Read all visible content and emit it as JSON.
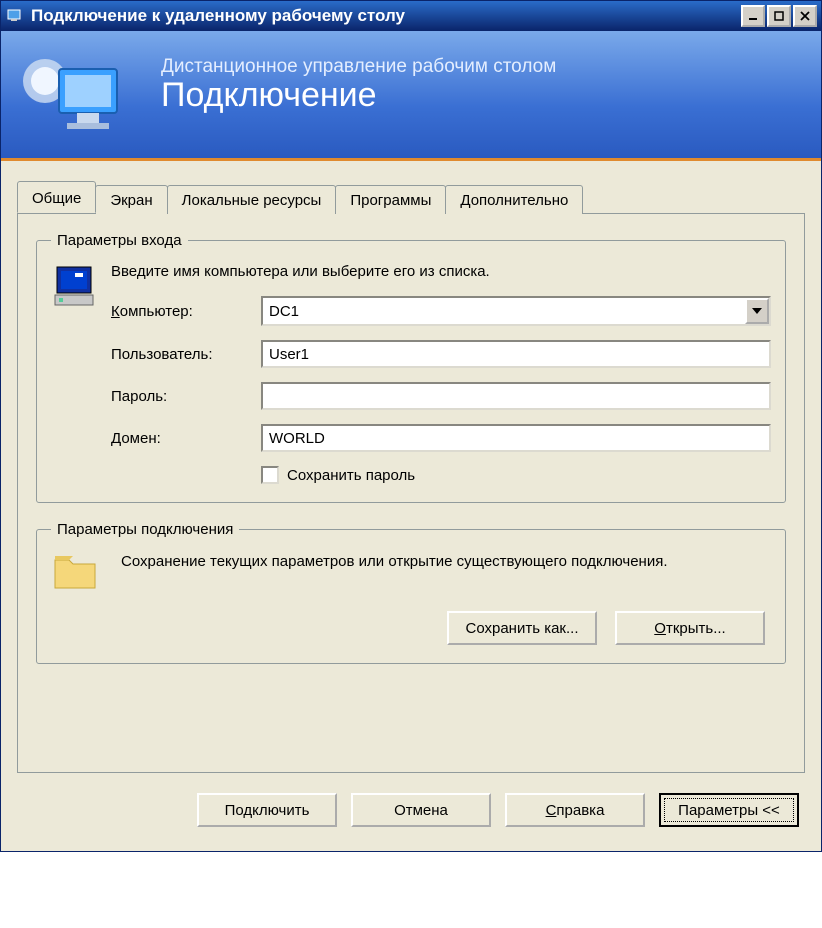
{
  "window": {
    "title": "Подключение к удаленному рабочему столу"
  },
  "banner": {
    "subtitle": "Дистанционное управление рабочим столом",
    "title": "Подключение"
  },
  "tabs": [
    {
      "label": "Общие",
      "active": true
    },
    {
      "label": "Экран",
      "active": false
    },
    {
      "label": "Локальные ресурсы",
      "active": false
    },
    {
      "label": "Программы",
      "active": false
    },
    {
      "label": "Дополнительно",
      "active": false
    }
  ],
  "login": {
    "legend": "Параметры входа",
    "instruction": "Введите имя компьютера или выберите его из списка.",
    "computer_label": "Компьютер:",
    "computer_value": "DC1",
    "user_label": "Пользователь:",
    "user_value": "User1",
    "password_label": "Пароль:",
    "password_value": "",
    "domain_label": "Домен:",
    "domain_value": "WORLD",
    "save_password_label": "Сохранить пароль",
    "save_password_checked": false
  },
  "connection": {
    "legend": "Параметры подключения",
    "description": "Сохранение текущих параметров или открытие существующего подключения.",
    "save_as_label": "Сохранить как...",
    "open_label": "Открыть..."
  },
  "buttons": {
    "connect": "Подключить",
    "cancel": "Отмена",
    "help": "Справка",
    "options": "Параметры <<"
  },
  "underlines": {
    "computer": "К",
    "domain": "Д",
    "open": "О",
    "connect": "д",
    "help": "С"
  }
}
